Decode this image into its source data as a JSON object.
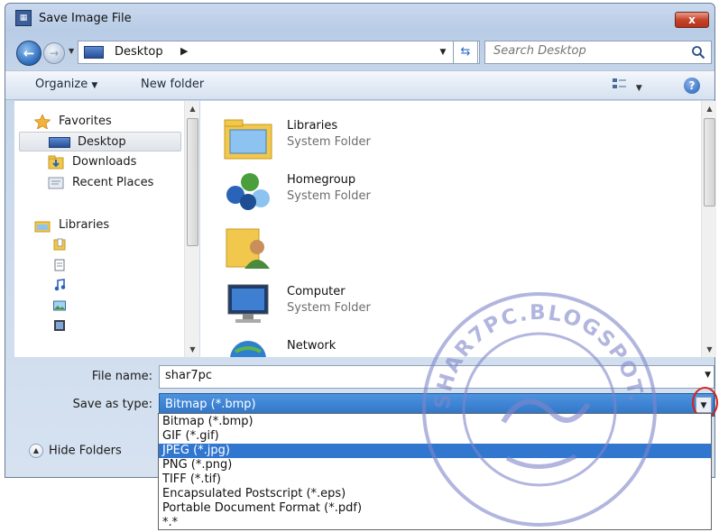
{
  "window": {
    "title": "Save Image File",
    "close_label": "x",
    "app_icon": "save-dialog-icon"
  },
  "address": {
    "location": "Desktop",
    "location_icon": "desktop-icon",
    "search_placeholder": "Search Desktop"
  },
  "toolbar": {
    "organize_label": "Organize",
    "new_folder_label": "New folder"
  },
  "nav": {
    "favorites_label": "Favorites",
    "items": [
      {
        "label": "Desktop",
        "icon": "desktop-icon",
        "selected": true
      },
      {
        "label": "Downloads",
        "icon": "downloads-folder-icon"
      },
      {
        "label": "Recent Places",
        "icon": "recent-places-icon"
      }
    ],
    "libraries_label": "Libraries",
    "library_icons": [
      "documents-library-icon",
      "document-icon",
      "music-icon",
      "pictures-icon",
      "videos-icon"
    ]
  },
  "files": [
    {
      "name": "Libraries",
      "type": "System Folder",
      "icon": "libraries-folder-icon"
    },
    {
      "name": "Homegroup",
      "type": "System Folder",
      "icon": "homegroup-icon"
    },
    {
      "name": "",
      "type": "",
      "icon": "user-folder-icon"
    },
    {
      "name": "Computer",
      "type": "System Folder",
      "icon": "computer-icon"
    },
    {
      "name": "Network",
      "type": "",
      "icon": "network-icon"
    }
  ],
  "form": {
    "file_name_label": "File name:",
    "file_name_value": "shar7pc",
    "save_type_label": "Save as type:",
    "save_type_value": "Bitmap (*.bmp)",
    "hide_folders_label": "Hide Folders"
  },
  "type_options": [
    "Bitmap (*.bmp)",
    "GIF (*.gif)",
    "JPEG (*.jpg)",
    "PNG (*.png)",
    "TIFF (*.tif)",
    "Encapsulated Postscript (*.eps)",
    "Portable Document Format (*.pdf)",
    "*.*"
  ],
  "selected_option_index": 2,
  "watermark": {
    "text": "SHAR7PC.BLOGSPOT.COM"
  },
  "colors": {
    "selection_blue": "#3277cf",
    "highlight_circle": "#d2231f"
  }
}
